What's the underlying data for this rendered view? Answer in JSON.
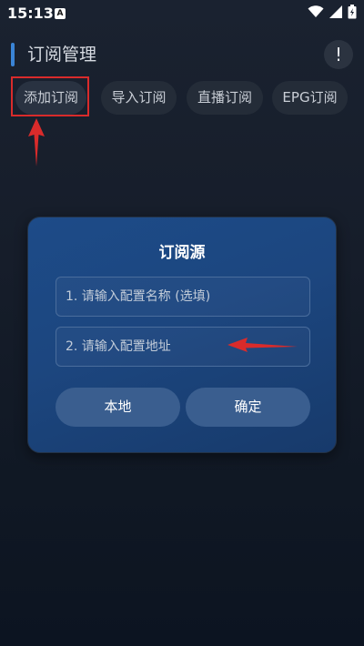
{
  "status_bar": {
    "time": "15:13",
    "notification_icon": "A",
    "icons": [
      "wifi-icon",
      "signal-icon",
      "battery-icon"
    ]
  },
  "header": {
    "title": "订阅管理",
    "info_button": "!"
  },
  "tabs": [
    {
      "label": "添加订阅"
    },
    {
      "label": "导入订阅"
    },
    {
      "label": "直播订阅"
    },
    {
      "label": "EPG订阅"
    }
  ],
  "dialog": {
    "title": "订阅源",
    "name_placeholder": "1. 请输入配置名称 (选填)",
    "url_placeholder": "2. 请输入配置地址",
    "local_button": "本地",
    "confirm_button": "确定"
  },
  "colors": {
    "accent": "#3a84d6",
    "dialog_bg": "#1c467f",
    "annotation_red": "#d92b2b"
  }
}
